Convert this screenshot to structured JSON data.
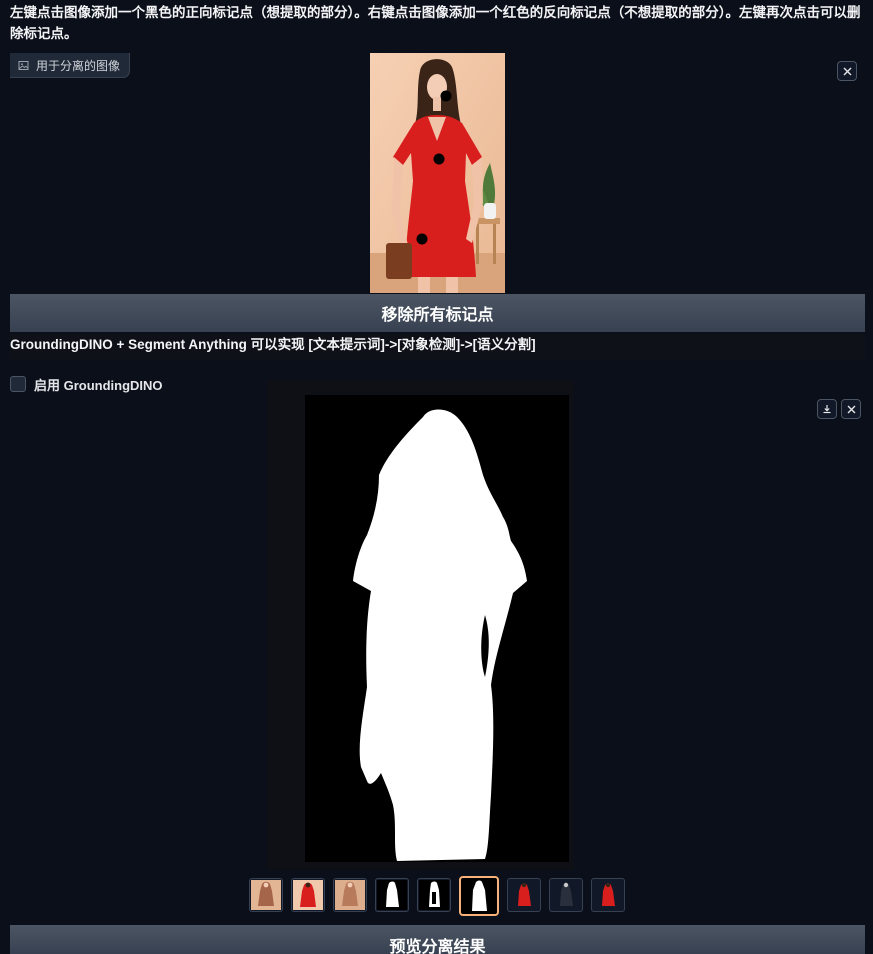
{
  "instructions": "左键点击图像添加一个黑色的正向标记点（想提取的部分）。右键点击图像添加一个红色的反向标记点（不想提取的部分）。左键再次点击可以删除标记点。",
  "image_input": {
    "label": "用于分离的图像",
    "label_icon": "image-icon",
    "close_icon": "close-icon"
  },
  "buttons": {
    "remove_all_points": "移除所有标记点",
    "preview_result": "预览分离结果"
  },
  "info": {
    "text": "GroundingDINO + Segment Anything 可以实现 [文本提示词]->[对象检测]->[语义分割]"
  },
  "checkbox": {
    "label": "启用 GroundingDINO",
    "checked": false
  },
  "result_gallery": {
    "download_icon": "download-icon",
    "close_icon": "close-icon",
    "thumbnails": [
      {
        "kind": "photo-full"
      },
      {
        "kind": "photo-red"
      },
      {
        "kind": "photo-full"
      },
      {
        "kind": "mask-white"
      },
      {
        "kind": "mask-partial"
      },
      {
        "kind": "mask-white",
        "selected": true
      },
      {
        "kind": "cutout-red"
      },
      {
        "kind": "cutout-dark"
      },
      {
        "kind": "cutout-red"
      }
    ]
  },
  "colors": {
    "background": "#0b0f19",
    "button_gradient_top": "#4b5563",
    "button_gradient_bottom": "#374151",
    "selected_thumb_border": "#f6b27a",
    "dress_red": "#d91e1e"
  }
}
